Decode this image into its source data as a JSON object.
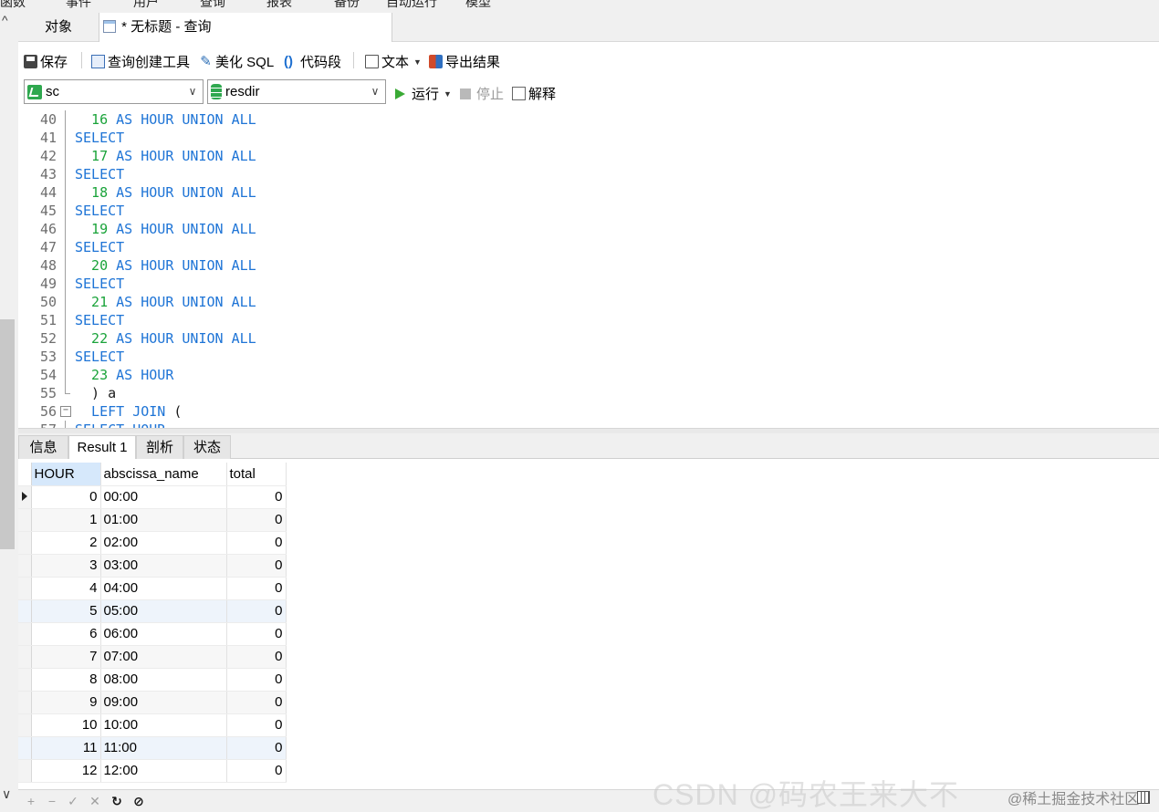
{
  "menu": [
    "函数",
    "事件",
    "用户",
    "查询",
    "报表",
    "备份",
    "自动运行",
    "模型"
  ],
  "tabs": {
    "objects": "对象",
    "query": "* 无标题 - 查询"
  },
  "toolbar": {
    "save": "保存",
    "query_builder": "查询创建工具",
    "beautify_sql": "美化 SQL",
    "snippet": "代码段",
    "text": "文本",
    "export_results": "导出结果"
  },
  "connection_combo": "sc",
  "database_combo": "resdir",
  "run": {
    "run": "运行",
    "stop": "停止",
    "explain": "解释"
  },
  "editor_lines": [
    {
      "n": "40",
      "parts": [
        [
          "num",
          "  16 "
        ],
        [
          "kw",
          "AS HOUR UNION ALL"
        ]
      ]
    },
    {
      "n": "41",
      "parts": [
        [
          "kw",
          "SELECT"
        ]
      ]
    },
    {
      "n": "42",
      "parts": [
        [
          "num",
          "  17 "
        ],
        [
          "kw",
          "AS HOUR UNION ALL"
        ]
      ]
    },
    {
      "n": "43",
      "parts": [
        [
          "kw",
          "SELECT"
        ]
      ]
    },
    {
      "n": "44",
      "parts": [
        [
          "num",
          "  18 "
        ],
        [
          "kw",
          "AS HOUR UNION ALL"
        ]
      ]
    },
    {
      "n": "45",
      "parts": [
        [
          "kw",
          "SELECT"
        ]
      ]
    },
    {
      "n": "46",
      "parts": [
        [
          "num",
          "  19 "
        ],
        [
          "kw",
          "AS HOUR UNION ALL"
        ]
      ]
    },
    {
      "n": "47",
      "parts": [
        [
          "kw",
          "SELECT"
        ]
      ]
    },
    {
      "n": "48",
      "parts": [
        [
          "num",
          "  20 "
        ],
        [
          "kw",
          "AS HOUR UNION ALL"
        ]
      ]
    },
    {
      "n": "49",
      "parts": [
        [
          "kw",
          "SELECT"
        ]
      ]
    },
    {
      "n": "50",
      "parts": [
        [
          "num",
          "  21 "
        ],
        [
          "kw",
          "AS HOUR UNION ALL"
        ]
      ]
    },
    {
      "n": "51",
      "parts": [
        [
          "kw",
          "SELECT"
        ]
      ]
    },
    {
      "n": "52",
      "parts": [
        [
          "num",
          "  22 "
        ],
        [
          "kw",
          "AS HOUR UNION ALL"
        ]
      ]
    },
    {
      "n": "53",
      "parts": [
        [
          "kw",
          "SELECT"
        ]
      ]
    },
    {
      "n": "54",
      "parts": [
        [
          "num",
          "  23 "
        ],
        [
          "kw",
          "AS HOUR"
        ]
      ]
    },
    {
      "n": "55",
      "parts": [
        [
          "txt",
          "  ) a"
        ]
      ]
    },
    {
      "n": "56",
      "parts": [
        [
          "kw",
          "  LEFT JOIN "
        ],
        [
          "txt",
          "("
        ]
      ]
    },
    {
      "n": "57",
      "parts": [
        [
          "kw",
          "SELECT HOUR"
        ]
      ]
    }
  ],
  "result_tabs": [
    "信息",
    "Result 1",
    "剖析",
    "状态"
  ],
  "result_columns": [
    "HOUR",
    "abscissa_name",
    "total"
  ],
  "result_rows": [
    [
      "0",
      "00:00",
      "0"
    ],
    [
      "1",
      "01:00",
      "0"
    ],
    [
      "2",
      "02:00",
      "0"
    ],
    [
      "3",
      "03:00",
      "0"
    ],
    [
      "4",
      "04:00",
      "0"
    ],
    [
      "5",
      "05:00",
      "0"
    ],
    [
      "6",
      "06:00",
      "0"
    ],
    [
      "7",
      "07:00",
      "0"
    ],
    [
      "8",
      "08:00",
      "0"
    ],
    [
      "9",
      "09:00",
      "0"
    ],
    [
      "10",
      "10:00",
      "0"
    ],
    [
      "11",
      "11:00",
      "0"
    ],
    [
      "12",
      "12:00",
      "0"
    ]
  ],
  "bottom_nav": [
    "+",
    "−",
    "✓",
    "✕"
  ],
  "watermark_faint": "CSDN @码农王来大不",
  "watermark": "@稀土掘金技术社区",
  "colors": {
    "keyword": "#1e74d6",
    "number": "#1aa33a",
    "run_green": "#3aaa35",
    "selected_header": "#d6e8fb"
  }
}
